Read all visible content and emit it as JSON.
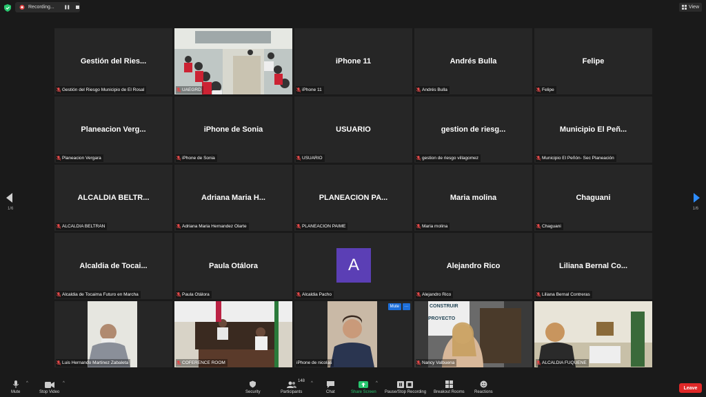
{
  "recording": {
    "label": "Recording..."
  },
  "view_button": {
    "label": "View"
  },
  "pagination": {
    "left": "1/6",
    "right": "1/6"
  },
  "tiles": [
    {
      "name": "Gestión del Ries...",
      "label": "Gestión del Riesgo Municipio de El Rosal"
    },
    {
      "name": "",
      "label": "UAEGRD",
      "video": true
    },
    {
      "name": "iPhone 11",
      "label": "iPhone 11"
    },
    {
      "name": "Andrés Bulla",
      "label": "Andrés Bulla"
    },
    {
      "name": "Felipe",
      "label": "Felipe"
    },
    {
      "name": "Planeacion Verg...",
      "label": "Planeacion Vergara"
    },
    {
      "name": "iPhone de Sonia",
      "label": "iPhone de Sonia"
    },
    {
      "name": "USUARIO",
      "label": "USUARIO"
    },
    {
      "name": "gestion de riesg...",
      "label": "gestion de riesgo villagomez"
    },
    {
      "name": "Municipio El Peñ...",
      "label": "Municipio El Peñón- Sec Planeación"
    },
    {
      "name": "ALCALDIA  BELTR...",
      "label": "ALCALDIA BELTRAN"
    },
    {
      "name": "Adriana Maria H...",
      "label": "Adriana Maria Hernandez Olarte"
    },
    {
      "name": "PLANEACION  PA...",
      "label": "PLANEACION PAIME"
    },
    {
      "name": "Maria molina",
      "label": "Maria molina"
    },
    {
      "name": "Chaguani",
      "label": "Chaguani"
    },
    {
      "name": "Alcaldia de Tocai...",
      "label": "Alcaldia de Tocaima Futuro en Marcha"
    },
    {
      "name": "Paula Otálora",
      "label": "Paula Otálora"
    },
    {
      "name": "",
      "label": "Alcaldia Pacho",
      "avatar": "A"
    },
    {
      "name": "Alejandro Rico",
      "label": "Alejandro Rico"
    },
    {
      "name": "Liliana Bernal Co...",
      "label": "Liliana Bernal Contreras"
    },
    {
      "name": "",
      "label": "Luis Hernando Martinez Zabaleta",
      "video": true
    },
    {
      "name": "",
      "label": "COFERENCE ROOM",
      "video": true
    },
    {
      "name": "",
      "label": "iPhone de nicolas",
      "video": true,
      "active": true
    },
    {
      "name": "",
      "label": "Nancy Valbuena",
      "video": true
    },
    {
      "name": "",
      "label": "ALCALDIA FUQUENE",
      "video": true
    }
  ],
  "tile_buttons": {
    "mute": "Mute",
    "more": "···"
  },
  "bg_sign": {
    "line1": "CONSTRUIR",
    "line2": "PROYECTO"
  },
  "toolbar": {
    "mute": "Mute",
    "stop_video": "Stop Video",
    "security": "Security",
    "participants": "Participants",
    "participants_count": "148",
    "chat": "Chat",
    "share_screen": "Share Screen",
    "pause_recording": "Pause/Stop Recording",
    "breakout_rooms": "Breakout Rooms",
    "reactions": "Reactions",
    "leave": "Leave"
  },
  "colors": {
    "accent_green": "#28c76f",
    "leave_red": "#e02828",
    "active_border": "#c8d94a",
    "avatar_purple": "#5b3fb5",
    "mute_blue": "#1e6fd9"
  }
}
